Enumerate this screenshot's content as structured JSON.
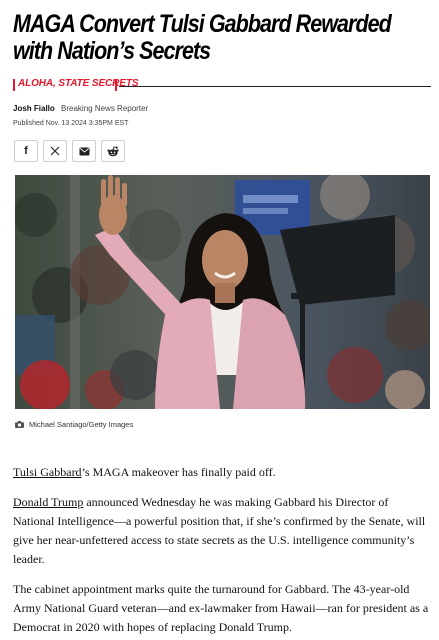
{
  "article": {
    "headline": "MAGA Convert Tulsi Gabbard Rewarded with Nation’s Secrets",
    "kicker": "ALOHA, STATE SECRETS",
    "author": "Josh Fiallo",
    "author_role": "Breaking News Reporter",
    "published": "Published Nov. 13 2024 3:35PM EST"
  },
  "share": [
    {
      "icon": "facebook-icon",
      "label": "f"
    },
    {
      "icon": "x-icon",
      "label": "𝕏"
    },
    {
      "icon": "email-icon",
      "label": ""
    },
    {
      "icon": "reddit-icon",
      "label": ""
    }
  ],
  "photo": {
    "caption": "Michael Santiago/Getty Images",
    "caption_icon": "camera-icon"
  },
  "body": {
    "p1_link": "Tulsi Gabbard",
    "p1_text": "’s MAGA makeover has finally paid off.",
    "p2_link": "Donald Trump",
    "p2_text": " announced Wednesday he was making Gabbard his Director of National Intelligence—a powerful position that, if she’s confirmed by the Senate, will give her near-unfettered access to state secrets as the U.S. intelligence community’s leader.",
    "p3_text": "The cabinet appointment marks quite the turnaround for Gabbard. The 43-year-old Army National Guard veteran—and ex-lawmaker from Hawaii—ran for president as a Democrat in 2020 with hopes of replacing Donald Trump."
  },
  "colors": {
    "accent": "#e4172b",
    "jacket": "#e3aab9",
    "background": "#ffffff"
  }
}
